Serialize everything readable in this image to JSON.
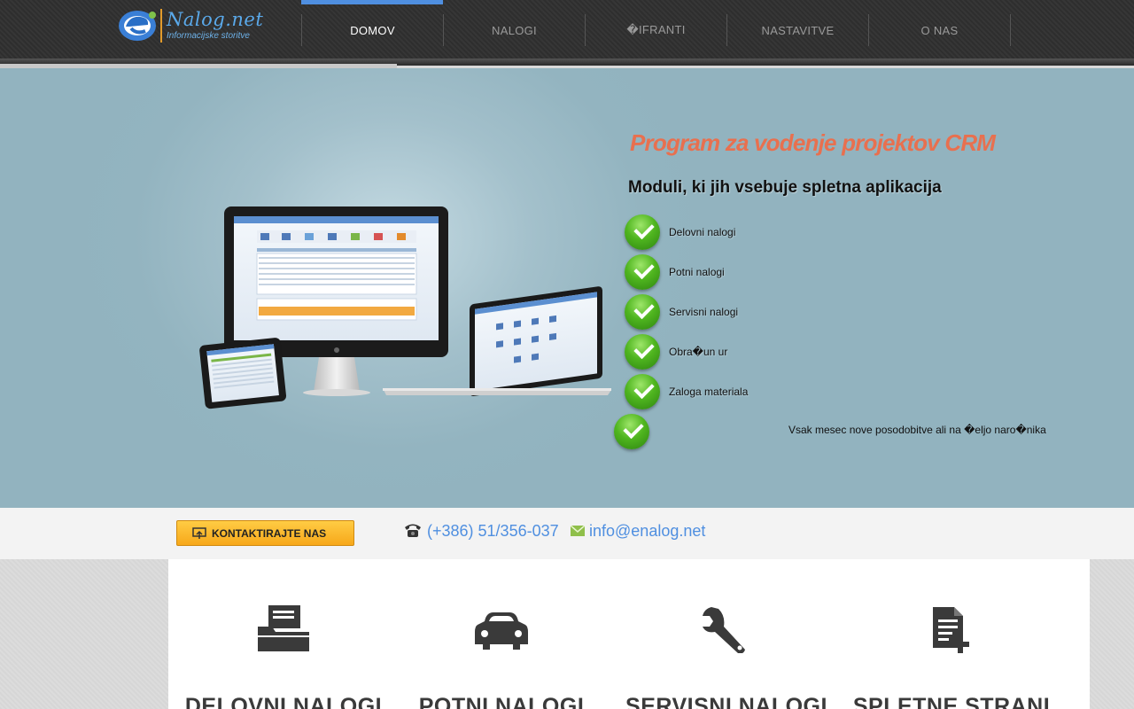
{
  "brand": {
    "name": "Nalog.net",
    "tagline": "Informacijske storitve"
  },
  "nav": {
    "items": [
      {
        "label": "DOMOV",
        "active": true
      },
      {
        "label": "NALOGI",
        "active": false
      },
      {
        "label": "�IFRANTI",
        "active": false
      },
      {
        "label": "NASTAVITVE",
        "active": false
      },
      {
        "label": "O NAS",
        "active": false
      }
    ]
  },
  "hero": {
    "title": "Program za vodenje projektov CRM",
    "subtitle": "Moduli, ki jih vsebuje spletna aplikacija",
    "features": [
      "Delovni nalogi",
      "Potni nalogi",
      "Servisni nalogi",
      "Obra�un ur",
      "Zaloga materiala"
    ],
    "update_note": "Vsak mesec nove posodobitve ali na �eljo naro�nika"
  },
  "contact": {
    "button_label": "KONTAKTIRAJTE NAS",
    "phone": "(+386) 51/356-037",
    "email": "info@enalog.net"
  },
  "services": [
    {
      "icon": "folder-icon",
      "title": "DELOVNI NALOGI"
    },
    {
      "icon": "car-icon",
      "title": "POTNI NALOGI"
    },
    {
      "icon": "wrench-icon",
      "title": "SERVISNI NALOGI"
    },
    {
      "icon": "document-add-icon",
      "title": "SPLETNE STRANI"
    }
  ],
  "colors": {
    "accent": "#4f8fe0",
    "hero_title": "#e8704f",
    "check": "#4fb51f",
    "contact_button": "#f7a81a"
  }
}
